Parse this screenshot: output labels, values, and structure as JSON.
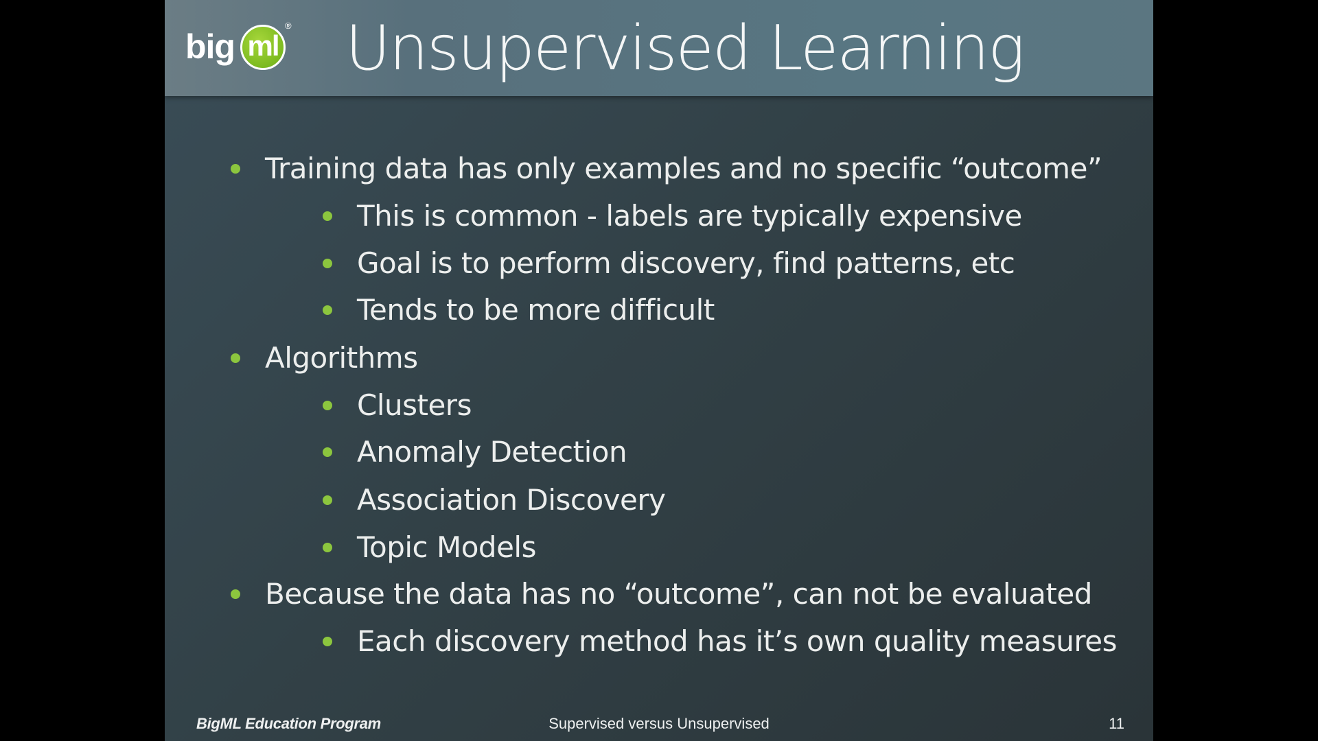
{
  "slide": {
    "logo_text": "big",
    "logo_badge": "ml",
    "logo_registered": "®",
    "title": "Unsupervised Learning",
    "accent_color": "#8cc63e",
    "bullets": [
      {
        "level": 1,
        "text": "Training data has only examples and no specific “outcome”"
      },
      {
        "level": 2,
        "text": "This is common - labels are typically expensive"
      },
      {
        "level": 2,
        "text": "Goal is to perform discovery, find patterns, etc"
      },
      {
        "level": 2,
        "text": "Tends to be more difficult"
      },
      {
        "level": 1,
        "text": "Algorithms"
      },
      {
        "level": 2,
        "text": "Clusters"
      },
      {
        "level": 2,
        "text": "Anomaly Detection"
      },
      {
        "level": 2,
        "text": "Association Discovery"
      },
      {
        "level": 2,
        "text": "Topic Models"
      },
      {
        "level": 1,
        "text": "Because the data has no “outcome”, can not be evaluated"
      },
      {
        "level": 2,
        "text": "Each discovery method has it’s own quality measures"
      }
    ],
    "footer": {
      "left": "BigML Education Program",
      "center": "Supervised versus Unsupervised",
      "page_number": "11"
    }
  }
}
